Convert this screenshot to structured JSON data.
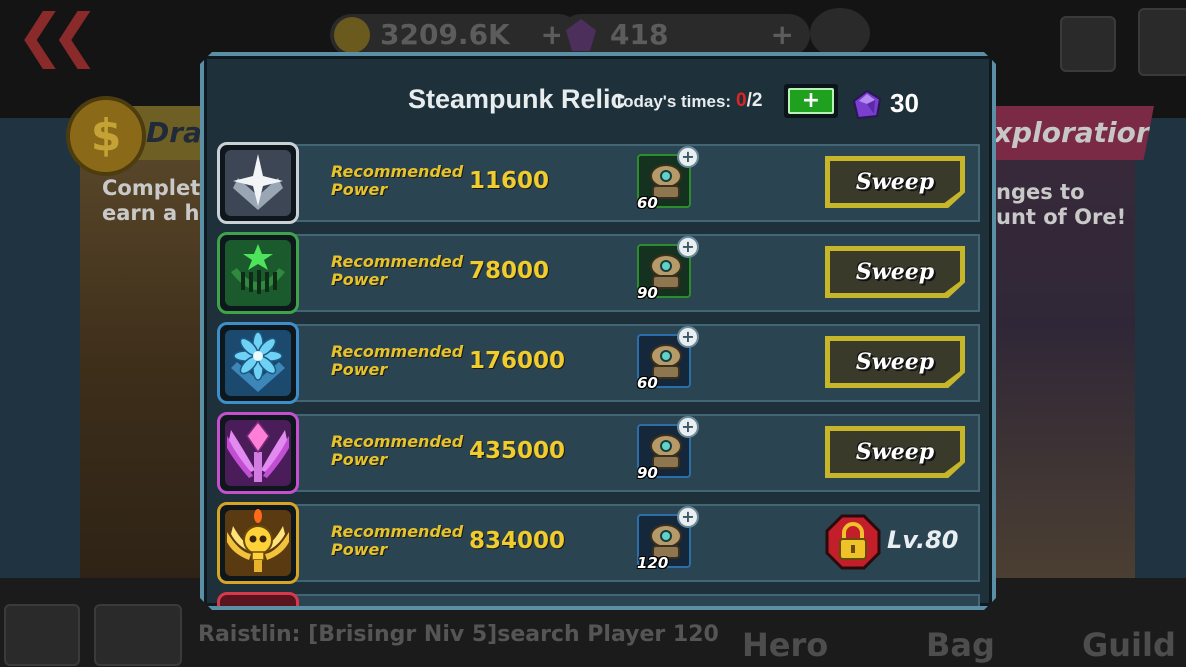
{
  "background": {
    "gold_amount": "3209.6K",
    "gem_amount": "418",
    "left_card": {
      "title": "Dra",
      "description_line1": "Complete",
      "description_line2": "earn a hug"
    },
    "right_card": {
      "title": "xploration",
      "description_line1": "nges to",
      "description_line2": "unt of Ore!"
    },
    "chat": "Raistlin: [Brisingr Niv 5]search Player 120",
    "nav": [
      "Hero",
      "Bag",
      "Guild"
    ]
  },
  "dialog": {
    "title": "Steampunk Relic",
    "times_label": "Today's times:",
    "times_used": "0",
    "times_total": "/2",
    "add_label": "+",
    "gem_count": "30"
  },
  "stages": [
    {
      "icon": "silver-star-emblem-icon",
      "label_line1": "Recommended",
      "label_line2": "Power",
      "power": "11600",
      "reward_qty": "60",
      "reward_frame": "green",
      "action": "Sweep",
      "locked": false
    },
    {
      "icon": "green-star-emblem-icon",
      "label_line1": "Recommended",
      "label_line2": "Power",
      "power": "78000",
      "reward_qty": "90",
      "reward_frame": "green",
      "action": "Sweep",
      "locked": false
    },
    {
      "icon": "blue-flower-emblem-icon",
      "label_line1": "Recommended",
      "label_line2": "Power",
      "power": "176000",
      "reward_qty": "60",
      "reward_frame": "blue",
      "action": "Sweep",
      "locked": false
    },
    {
      "icon": "purple-crystal-emblem-icon",
      "label_line1": "Recommended",
      "label_line2": "Power",
      "power": "435000",
      "reward_qty": "90",
      "reward_frame": "blue",
      "action": "Sweep",
      "locked": false
    },
    {
      "icon": "golden-skull-emblem-icon",
      "label_line1": "Recommended",
      "label_line2": "Power",
      "power": "834000",
      "reward_qty": "120",
      "reward_frame": "blue",
      "action": "Lv.80",
      "locked": true
    }
  ],
  "colors": {
    "accent_gold": "#f0cc2c",
    "times_used_red": "#e02424",
    "sweep_border": "#c8b62a"
  }
}
